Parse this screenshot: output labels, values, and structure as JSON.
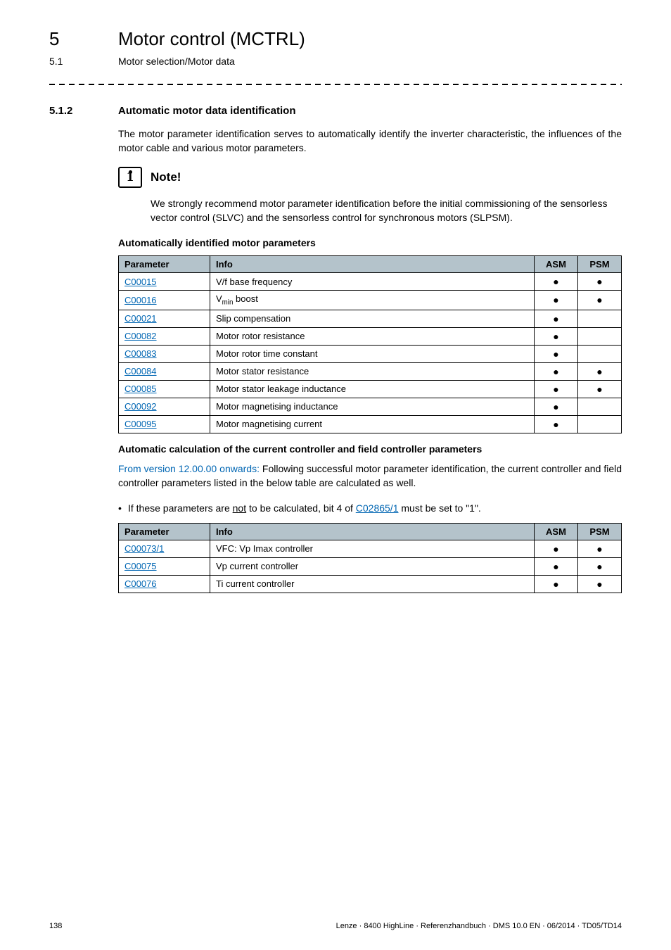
{
  "header": {
    "chapter_num": "5",
    "chapter_title": "Motor control (MCTRL)",
    "section_num": "5.1",
    "section_title": "Motor selection/Motor data"
  },
  "section": {
    "num": "5.1.2",
    "title": "Automatic  motor data identification",
    "intro": "The motor parameter identification serves to automatically identify the inverter characteristic, the influences of the motor cable and various motor parameters."
  },
  "note": {
    "label": "Note!",
    "body": "We strongly recommend motor parameter identification before the initial commissioning of the sensorless vector control (SLVC) and the sensorless control for synchronous motors (SLPSM)."
  },
  "auto_params": {
    "heading": "Automatically identified motor parameters",
    "cols": {
      "param": "Parameter",
      "info": "Info",
      "asm": "ASM",
      "psm": "PSM"
    },
    "rows": [
      {
        "param": "C00015",
        "info": "V/f base frequency",
        "asm": true,
        "psm": true
      },
      {
        "param": "C00016",
        "info_html": "V<sub>min</sub> boost",
        "asm": true,
        "psm": true
      },
      {
        "param": "C00021",
        "info": "Slip compensation",
        "asm": true,
        "psm": false
      },
      {
        "param": "C00082",
        "info": "Motor rotor resistance",
        "asm": true,
        "psm": false
      },
      {
        "param": "C00083",
        "info": "Motor rotor time constant",
        "asm": true,
        "psm": false
      },
      {
        "param": "C00084",
        "info": "Motor stator resistance",
        "asm": true,
        "psm": true
      },
      {
        "param": "C00085",
        "info": "Motor stator leakage inductance",
        "asm": true,
        "psm": true
      },
      {
        "param": "C00092",
        "info": "Motor magnetising inductance",
        "asm": true,
        "psm": false
      },
      {
        "param": "C00095",
        "info": "Motor magnetising current",
        "asm": true,
        "psm": false
      }
    ]
  },
  "auto_calc": {
    "heading": "Automatic calculation of the current controller and field controller parameters",
    "version_prefix": "From version 12.00.00 onwards:",
    "para_rest": " Following successful motor parameter identification, the current controller and field controller parameters listed in the below table are calculated as well.",
    "bullet_pre": "If these parameters are ",
    "bullet_not": "not",
    "bullet_mid": " to be calculated, bit 4 of ",
    "bullet_link": "C02865/1",
    "bullet_post": " must be set to \"1\".",
    "cols": {
      "param": "Parameter",
      "info": "Info",
      "asm": "ASM",
      "psm": "PSM"
    },
    "rows": [
      {
        "param": "C00073/1",
        "info": "VFC: Vp Imax controller",
        "asm": true,
        "psm": true
      },
      {
        "param": "C00075",
        "info": "Vp current controller",
        "asm": true,
        "psm": true
      },
      {
        "param": "C00076",
        "info": "Ti current controller",
        "asm": true,
        "psm": true
      }
    ]
  },
  "footer": {
    "page": "138",
    "meta": "Lenze · 8400 HighLine · Referenzhandbuch · DMS 10.0 EN · 06/2014 · TD05/TD14"
  },
  "glyphs": {
    "dot": "●"
  }
}
